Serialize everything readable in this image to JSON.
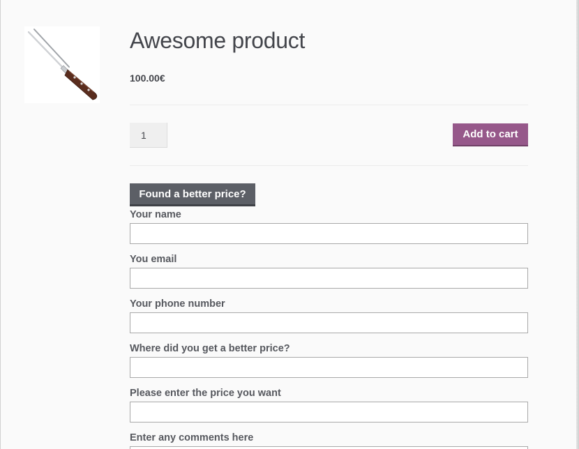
{
  "product": {
    "title": "Awesome product",
    "price": "100.00€",
    "quantity": "1",
    "add_to_cart_label": "Add to cart",
    "image_icon": "carving-fork-icon"
  },
  "better_price": {
    "toggle_label": "Found a better price?",
    "fields": [
      {
        "label": "Your name",
        "value": ""
      },
      {
        "label": "You email",
        "value": ""
      },
      {
        "label": "Your phone number",
        "value": ""
      },
      {
        "label": "Where did you get a better price?",
        "value": ""
      },
      {
        "label": "Please enter the price you want",
        "value": ""
      },
      {
        "label": "Enter any comments here",
        "value": ""
      }
    ]
  },
  "colors": {
    "accent": "#96588a",
    "secondary_button": "#5c5f66",
    "text": "#43454b",
    "background": "#fafafa"
  }
}
